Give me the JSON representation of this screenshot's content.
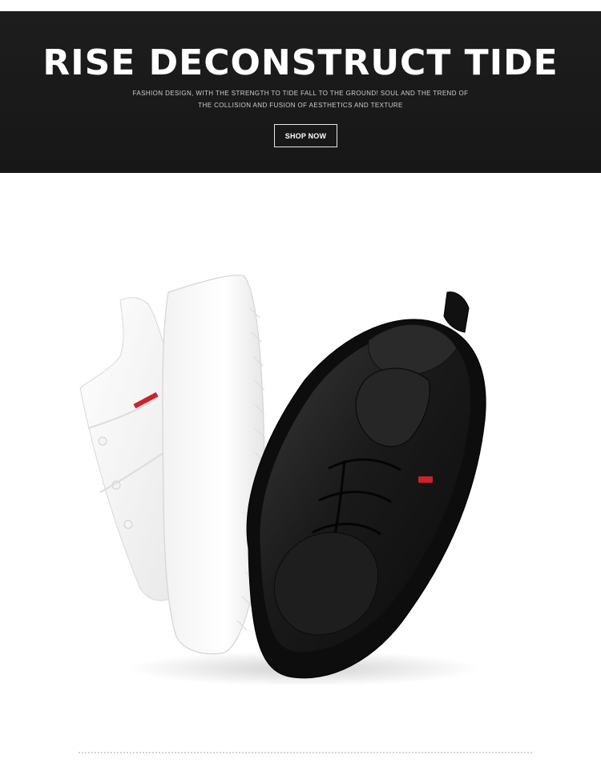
{
  "hero": {
    "title": "RISE DECONSTRUCT TIDE",
    "subtitle_line1": "FASHION DESIGN, WITH THE STRENGTH TO TIDE FALL TO THE GROUND! SOUL AND THE TREND OF",
    "subtitle_line2": "THE COLLISION AND FUSION OF AESTHETICS AND TEXTURE",
    "button_label": "SHOP NOW"
  },
  "colors": {
    "banner_bg": "#1b1b1b",
    "accent_tag": "#c8242a",
    "white_shoe": "#f6f6f6",
    "black_shoe": "#141414"
  },
  "product": {
    "icon": "sneakers-pair-image"
  }
}
